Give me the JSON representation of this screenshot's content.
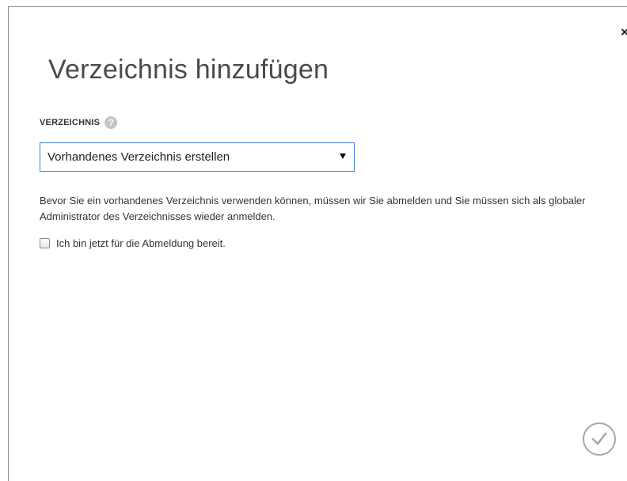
{
  "dialog": {
    "close_symbol": "×",
    "title": "Verzeichnis hinzufügen",
    "field": {
      "label": "VERZEICHNIS",
      "help_symbol": "?",
      "selected_value": "Vorhandenes Verzeichnis erstellen"
    },
    "description": "Bevor Sie ein vorhandenes Verzeichnis verwenden können, müssen wir Sie abmelden und Sie müssen sich als globaler Administrator des Verzeichnisses wieder anmelden.",
    "checkbox": {
      "label": "Ich bin jetzt für die Abmeldung bereit.",
      "checked": false
    },
    "icons": {
      "close": "close-icon",
      "help": "help-icon",
      "dropdown": "chevron-down-icon",
      "confirm": "checkmark-icon"
    },
    "colors": {
      "accent_border": "#3f7fd0",
      "title_text": "#4a4a4a",
      "help_icon_bg": "#c4c4c4",
      "confirm_border": "#a8a8a8"
    }
  }
}
